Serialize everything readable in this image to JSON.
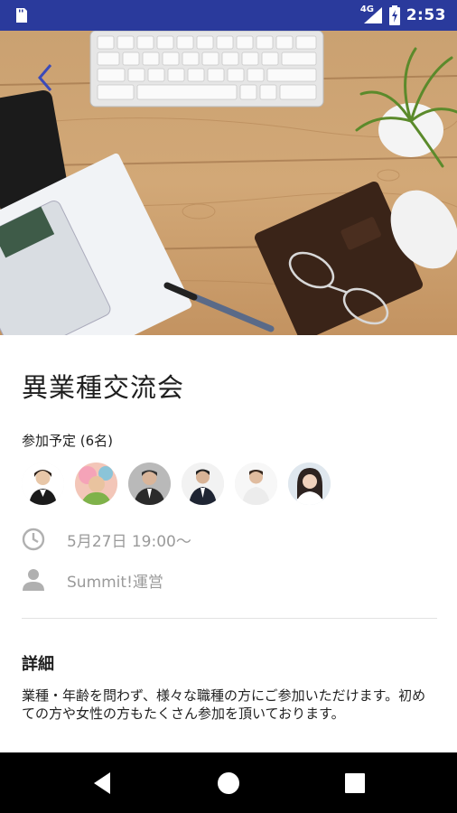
{
  "status_bar": {
    "network": "4G",
    "time": "2:53"
  },
  "event": {
    "title": "異業種交流会",
    "attendees_label": "参加予定 (6名)",
    "attendees": [
      {
        "name": "attendee-1"
      },
      {
        "name": "attendee-2"
      },
      {
        "name": "attendee-3"
      },
      {
        "name": "attendee-4"
      },
      {
        "name": "attendee-5"
      },
      {
        "name": "attendee-6"
      }
    ],
    "datetime": "5月27日 19:00〜",
    "organizer": "Summit!運営",
    "detail_heading": "詳細",
    "detail_body": "業種・年齢を問わず、様々な職種の方にご参加いただけます。初めての方や女性の方もたくさん参加を頂いております。"
  },
  "colors": {
    "status_bar": "#2a3a9c",
    "back_arrow": "#3b4ab8",
    "icon_gray": "#b0b0b0"
  }
}
